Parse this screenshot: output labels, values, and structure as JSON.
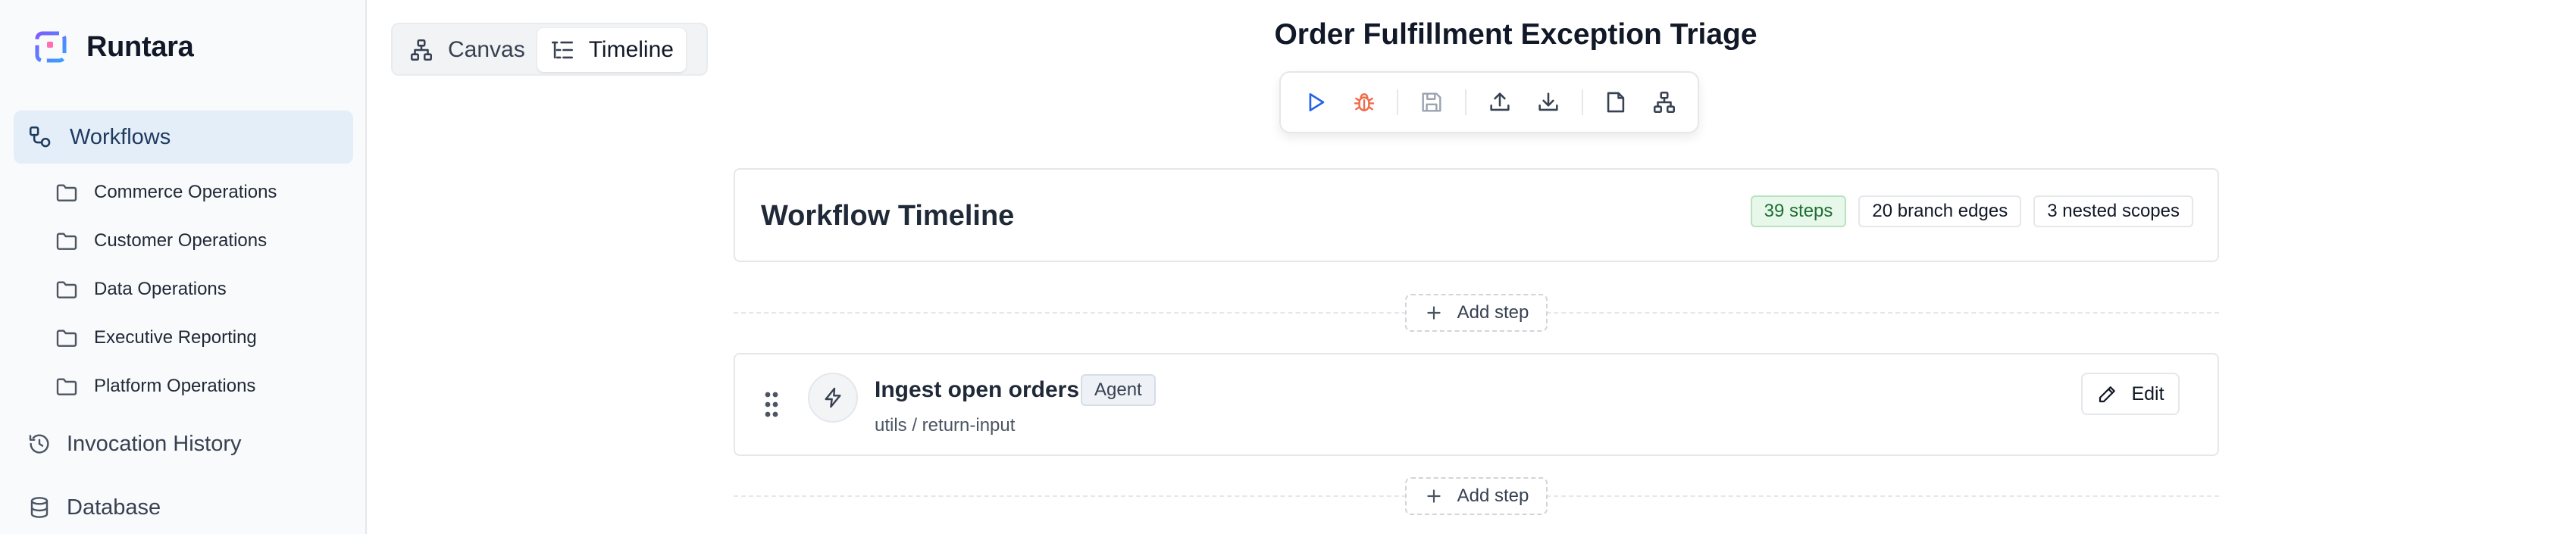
{
  "app": {
    "name": "Runtara"
  },
  "sidebar": {
    "active_item": {
      "label": "Workflows",
      "icon": "workflow-icon"
    },
    "folders": [
      {
        "label": "Commerce Operations",
        "icon": "folder-icon"
      },
      {
        "label": "Customer Operations",
        "icon": "folder-icon"
      },
      {
        "label": "Data Operations",
        "icon": "folder-icon"
      },
      {
        "label": "Executive Reporting",
        "icon": "folder-icon"
      },
      {
        "label": "Platform Operations",
        "icon": "folder-icon"
      }
    ],
    "items": [
      {
        "label": "Invocation History",
        "icon": "history-icon"
      },
      {
        "label": "Database",
        "icon": "database-icon"
      }
    ]
  },
  "view_toggle": {
    "canvas_label": "Canvas",
    "timeline_label": "Timeline",
    "selected": "Timeline"
  },
  "header": {
    "title": "Order Fulfillment Exception Triage"
  },
  "toolbar": {
    "buttons": [
      "play-icon",
      "debug-icon",
      "save-icon",
      "upload-icon",
      "download-icon",
      "file-icon",
      "hierarchy-icon"
    ],
    "colors": {
      "play": "#2563eb",
      "debug": "#ef6b4a",
      "disabled": "#9ca3af",
      "default": "#374151"
    }
  },
  "timeline": {
    "title": "Workflow Timeline",
    "badges": {
      "steps": "39 steps",
      "branch_edges": "20 branch edges",
      "nested_scopes": "3 nested scopes"
    }
  },
  "add_step_label": "Add step",
  "steps": [
    {
      "title": "Ingest open orders",
      "badge": "Agent",
      "subtitle": "utils / return-input",
      "edit_label": "Edit",
      "icon": "lightning-icon"
    }
  ]
}
